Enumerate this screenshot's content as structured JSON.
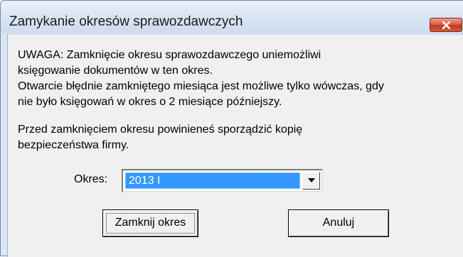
{
  "window": {
    "title": "Zamykanie okresów sprawozdawczych",
    "close_icon": "close-icon"
  },
  "message": {
    "warning_line1": "UWAGA: Zamknięcie okresu sprawozdawczego uniemożliwi",
    "warning_line2": "księgowanie dokumentów w ten okres.",
    "warning_line3": "Otwarcie błędnie zamkniętego miesiąca jest możliwe tylko wówczas, gdy",
    "warning_line4": "nie było księgowań w okres o 2 miesiące późniejszy.",
    "backup_line1": "Przed zamknięciem okresu powinieneś sporządzić kopię",
    "backup_line2": "bezpieczeństwa firmy."
  },
  "okres": {
    "label": "Okres:",
    "selected": "2013 I"
  },
  "buttons": {
    "close_period": "Zamknij okres",
    "cancel": "Anuluj"
  },
  "colors": {
    "selection": "#3399ff",
    "close_button": "#c7432a",
    "dialog_bg": "#f0f0f0",
    "frame": "#dce7f4"
  }
}
